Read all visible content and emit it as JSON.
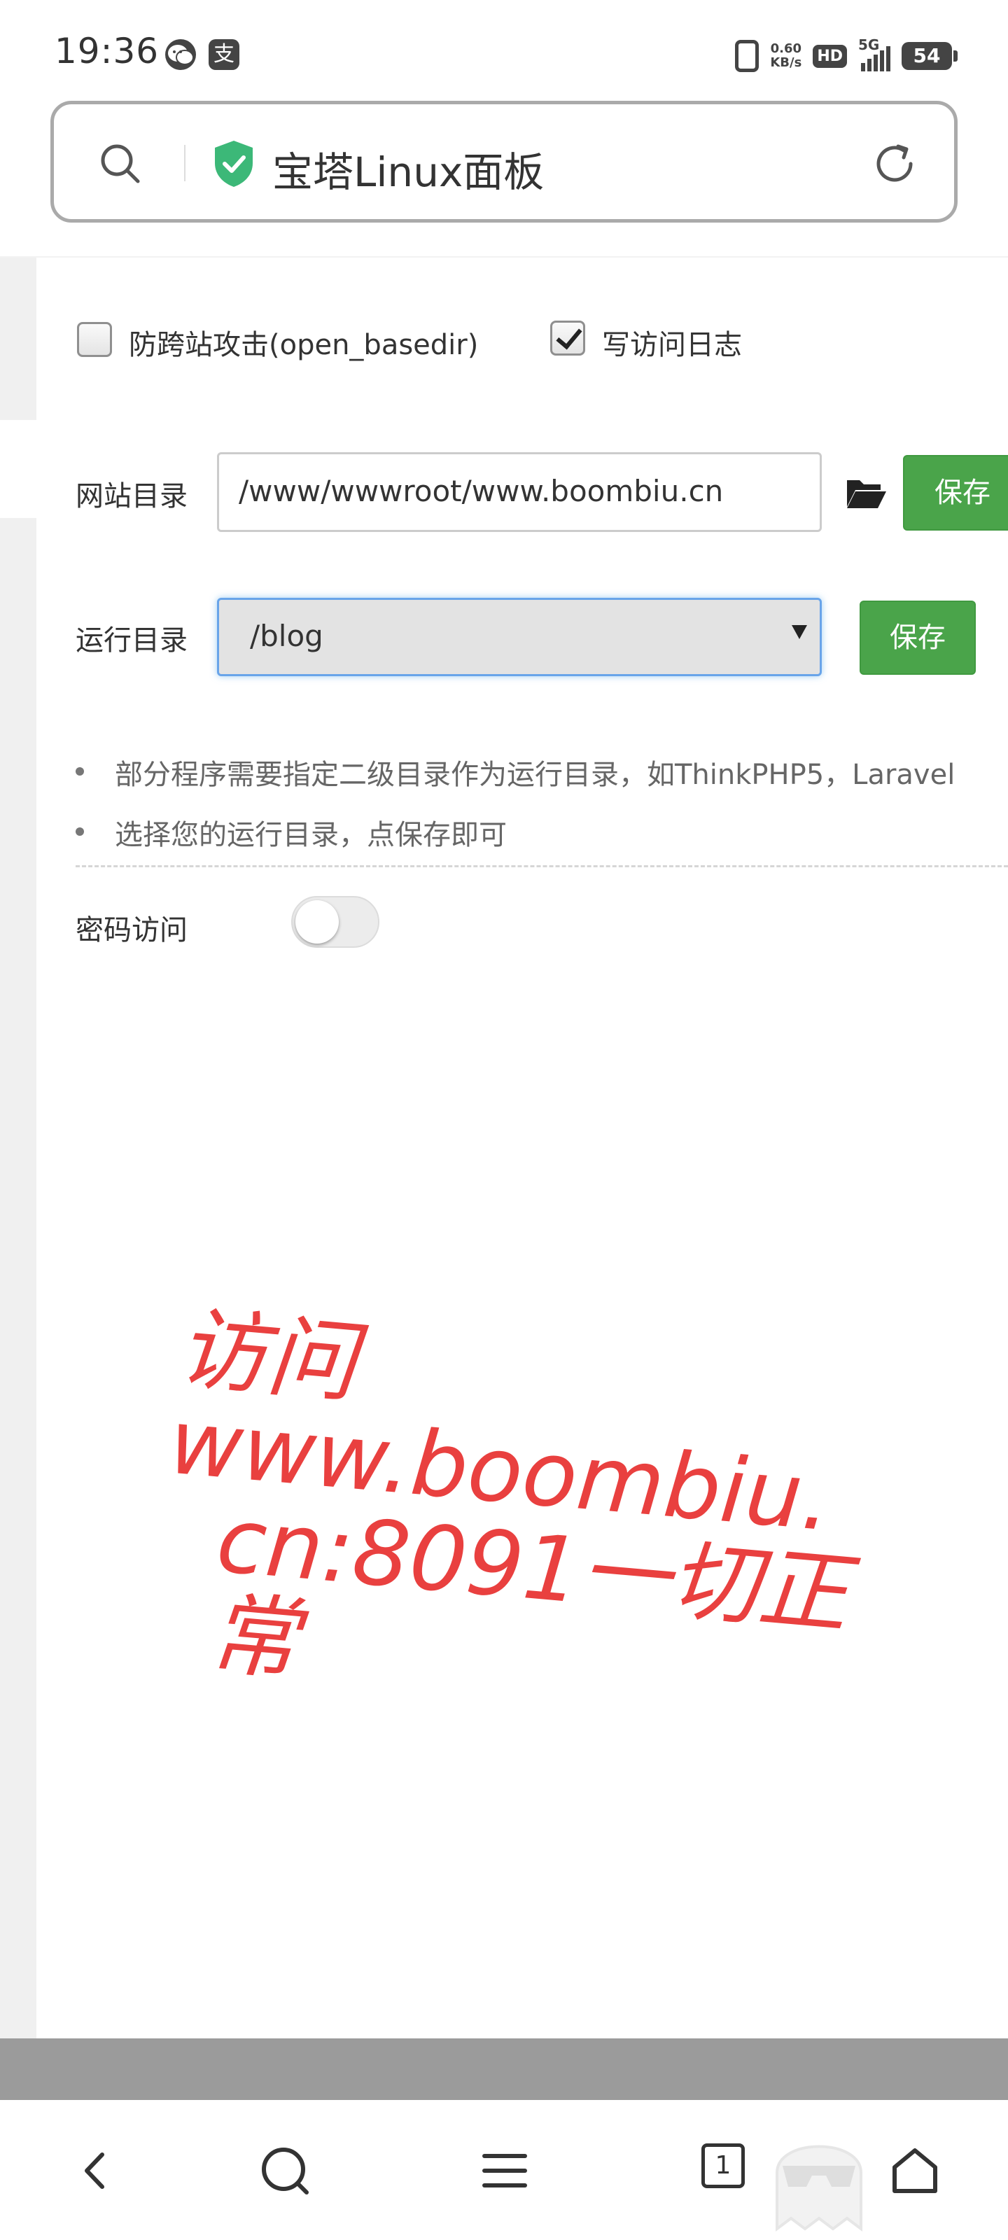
{
  "status_bar": {
    "time": "19:36",
    "app_icons": [
      "wechat-icon",
      "alipay-icon"
    ],
    "alipay_glyph": "支",
    "net_speed_value": "0.60",
    "net_speed_unit": "KB/s",
    "hd_label": "HD",
    "network_label": "5G",
    "battery": "54"
  },
  "address_bar": {
    "title": "宝塔Linux面板",
    "secure_color": "#3cb878"
  },
  "form": {
    "checkbox_open_basedir": {
      "label": "防跨站攻击(open_basedir)",
      "checked": false
    },
    "checkbox_access_log": {
      "label": "写访问日志",
      "checked": true
    },
    "site_dir": {
      "label": "网站目录",
      "value": "/www/wwwroot/www.boombiu.cn",
      "save_label": "保存"
    },
    "run_dir": {
      "label": "运行目录",
      "selected": "/blog",
      "save_label": "保存"
    },
    "tips": [
      "部分程序需要指定二级目录作为运行目录，如ThinkPHP5，Laravel",
      "选择您的运行目录，点保存即可"
    ],
    "password_access": {
      "label": "密码访问",
      "enabled": false
    }
  },
  "annotation": {
    "line1": "访问www.boombiu.",
    "line2": "cn:8091一切正常",
    "color": "#e9403f"
  },
  "nav_bar": {
    "tab_count": "1"
  },
  "colors": {
    "accent_green": "#4aa44a",
    "focus_blue": "#69a4e9"
  }
}
